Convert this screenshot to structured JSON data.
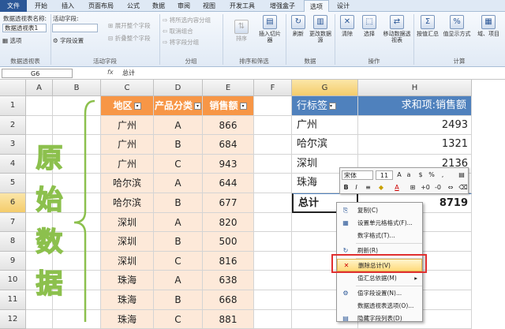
{
  "tabs": [
    "文件",
    "开始",
    "插入",
    "页面布局",
    "公式",
    "数据",
    "审阅",
    "视图",
    "开发工具",
    "增强盒子",
    "选项",
    "设计"
  ],
  "ribbon": {
    "pivot_name_label": "数据透视表名称:",
    "pivot_name_value": "数据透视表1",
    "options_btn": "选项",
    "active_field_label": "活动字段:",
    "field_settings_btn": "字段设置",
    "expand_btn": "展开整个字段",
    "collapse_btn": "折叠整个字段",
    "group_sel": "将所选内容分组",
    "ungroup": "取消组合",
    "group_field": "将字段分组",
    "sort_btn": "排序",
    "insert_slicer": "插入切片器",
    "refresh_btn": "刷新",
    "change_source": "更改数据源",
    "clear_btn": "清除",
    "select_btn": "选择",
    "move_pivot": "移动数据透视表",
    "summarize_by": "按值汇总",
    "show_values_as": "值显示方式",
    "fields_items": "域、项目",
    "groups": [
      "数据透视表",
      "活动字段",
      "分组",
      "排序和筛选",
      "数据",
      "操作",
      "计算"
    ]
  },
  "formula_bar": {
    "name_box": "G6",
    "fx": "fx",
    "content": "总计"
  },
  "columns": [
    "A",
    "B",
    "C",
    "D",
    "E",
    "F",
    "G",
    "H"
  ],
  "rows": [
    "1",
    "2",
    "3",
    "4",
    "5",
    "6",
    "7",
    "8",
    "9",
    "10",
    "11",
    "12"
  ],
  "source_table": {
    "headers": [
      "地区",
      "产品分类",
      "销售额"
    ],
    "rows": [
      [
        "广州",
        "A",
        "866"
      ],
      [
        "广州",
        "B",
        "684"
      ],
      [
        "广州",
        "C",
        "943"
      ],
      [
        "哈尔滨",
        "A",
        "644"
      ],
      [
        "哈尔滨",
        "B",
        "677"
      ],
      [
        "深圳",
        "A",
        "820"
      ],
      [
        "深圳",
        "B",
        "500"
      ],
      [
        "深圳",
        "C",
        "816"
      ],
      [
        "珠海",
        "A",
        "638"
      ],
      [
        "珠海",
        "B",
        "668"
      ],
      [
        "珠海",
        "C",
        "881"
      ]
    ]
  },
  "side_label": [
    "原",
    "始",
    "数",
    "据"
  ],
  "pivot": {
    "row_label_hdr": "行标签",
    "value_hdr": "求和项:销售额",
    "rows": [
      [
        "广州",
        "2493"
      ],
      [
        "哈尔滨",
        "1321"
      ],
      [
        "深圳",
        "2136"
      ],
      [
        "珠海",
        ""
      ]
    ],
    "total_label": "总计",
    "total_value": "8719"
  },
  "mini_toolbar": {
    "font": "宋体",
    "size": "11"
  },
  "context_menu": [
    "复制(C)",
    "设置单元格格式(F)...",
    "数字格式(T)...",
    "刷新(R)",
    "删除总计(V)",
    "值汇总依据(M)",
    "值字段设置(N)...",
    "数据透视表选项(O)...",
    "隐藏字段列表(D)"
  ],
  "colors": {
    "header_orange": "#f79646",
    "data_peach": "#fde9d9",
    "pivot_blue": "#4f81bd",
    "label_green": "#8cc04d"
  }
}
